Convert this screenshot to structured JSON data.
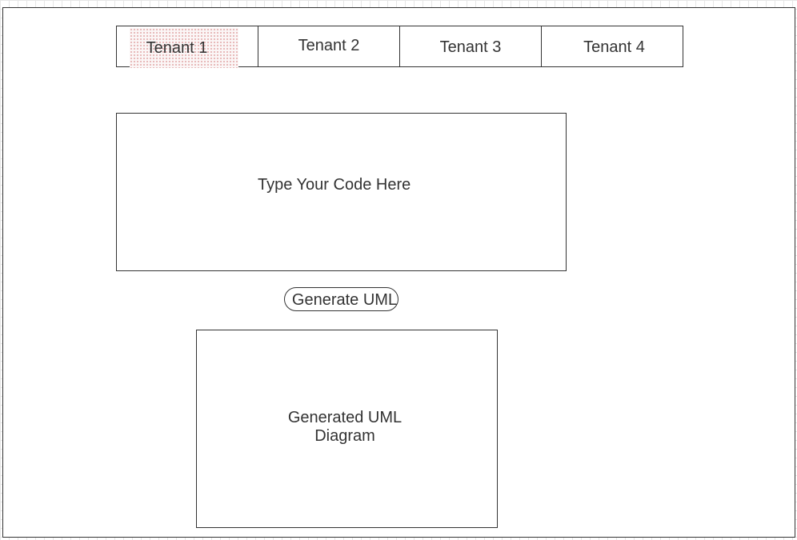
{
  "tabs": [
    {
      "label": "Tenant 1",
      "active": true
    },
    {
      "label": "Tenant 2",
      "active": false
    },
    {
      "label": "Tenant 3",
      "active": false
    },
    {
      "label": "Tenant 4",
      "active": false
    }
  ],
  "editor": {
    "placeholder": "Type Your Code Here"
  },
  "actions": {
    "generate_label": "Generate UML"
  },
  "output": {
    "label": "Generated UML\n  Diagram"
  },
  "colors": {
    "stroke": "#333333",
    "grid": "#e6e6e6",
    "active_tab_dots": "#e2a6a6"
  }
}
